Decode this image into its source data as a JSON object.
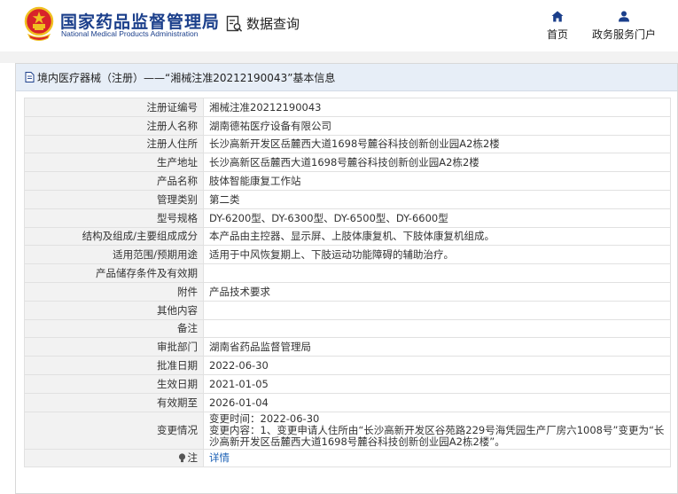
{
  "header": {
    "org_name_cn": "国家药品监督管理局",
    "org_name_en": "National Medical Products Administration",
    "query_label": "数据查询",
    "nav": [
      {
        "label": "首页",
        "icon": "home-icon"
      },
      {
        "label": "政务服务门户",
        "icon": "user-icon"
      }
    ]
  },
  "panel": {
    "title": "境内医疗器械（注册）——“湘械注准20212190043”基本信息"
  },
  "fields": [
    {
      "label": "注册证编号",
      "value": "湘械注准20212190043"
    },
    {
      "label": "注册人名称",
      "value": "湖南德祐医疗设备有限公司"
    },
    {
      "label": "注册人住所",
      "value": "长沙高新开发区岳麓西大道1698号麓谷科技创新创业园A2栋2楼"
    },
    {
      "label": "生产地址",
      "value": "长沙高新区岳麓西大道1698号麓谷科技创新创业园A2栋2楼"
    },
    {
      "label": "产品名称",
      "value": "肢体智能康复工作站"
    },
    {
      "label": "管理类别",
      "value": "第二类"
    },
    {
      "label": "型号规格",
      "value": "DY-6200型、DY-6300型、DY-6500型、DY-6600型"
    },
    {
      "label": "结构及组成/主要组成成分",
      "value": "本产品由主控器、显示屏、上肢体康复机、下肢体康复机组成。"
    },
    {
      "label": "适用范围/预期用途",
      "value": "适用于中风恢复期上、下肢运动功能障碍的辅助治疗。"
    },
    {
      "label": "产品储存条件及有效期",
      "value": ""
    },
    {
      "label": "附件",
      "value": "产品技术要求"
    },
    {
      "label": "其他内容",
      "value": ""
    },
    {
      "label": "备注",
      "value": ""
    },
    {
      "label": "审批部门",
      "value": "湖南省药品监督管理局"
    },
    {
      "label": "批准日期",
      "value": "2022-06-30"
    },
    {
      "label": "生效日期",
      "value": "2021-01-05"
    },
    {
      "label": "有效期至",
      "value": "2026-01-04"
    }
  ],
  "change": {
    "label": "变更情况",
    "line1": "变更时间：2022-06-30",
    "line2": "变更内容：1、变更申请人住所由“长沙高新开发区谷苑路229号海凭园生产厂房六1008号”变更为“长沙高新开发区岳麓西大道1698号麓谷科技创新创业园A2栋2楼”。"
  },
  "note": {
    "label": "注",
    "link": "详情",
    "icon": "lightbulb-icon"
  },
  "colors": {
    "brand_blue": "#1b3f8b",
    "emblem_red": "#d8232a",
    "emblem_gold": "#f0c020",
    "title_bg": "#e7eef7",
    "label_bg": "#f2f2f2",
    "link": "#1a5fb4"
  }
}
